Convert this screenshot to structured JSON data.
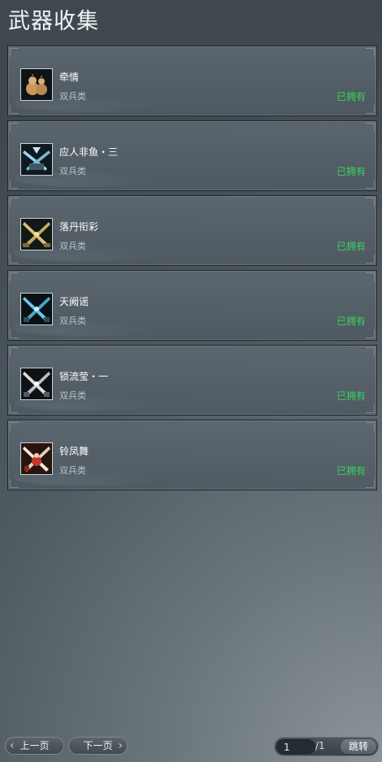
{
  "page": {
    "title": "武器收集"
  },
  "weapons": [
    {
      "name": "牵情",
      "category": "双兵类",
      "status": "已拥有",
      "icon": "gourd-weapon-icon"
    },
    {
      "name": "应人非鱼・三",
      "category": "双兵类",
      "status": "已拥有",
      "icon": "twin-blades-icon"
    },
    {
      "name": "落丹衔彩",
      "category": "双兵类",
      "status": "已拥有",
      "icon": "golden-crossed-blades-icon"
    },
    {
      "name": "天阙谣",
      "category": "双兵类",
      "status": "已拥有",
      "icon": "blue-crossed-blades-icon"
    },
    {
      "name": "锁流莹・一",
      "category": "双兵类",
      "status": "已拥有",
      "icon": "silver-crossed-blades-icon"
    },
    {
      "name": "铃凤舞",
      "category": "双兵类",
      "status": "已拥有",
      "icon": "dancer-blades-icon"
    }
  ],
  "pager": {
    "prev_label": "上一页",
    "next_label": "下一页",
    "current_page": "1",
    "total_pages": "/1",
    "jump_label": "跳转"
  },
  "colors": {
    "owned": "#38d35a"
  }
}
